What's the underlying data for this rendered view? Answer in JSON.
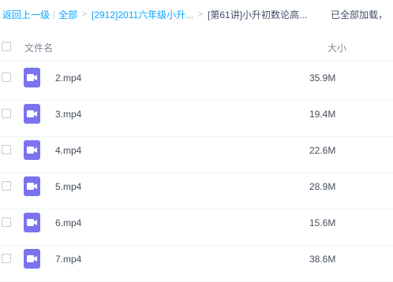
{
  "breadcrumb": {
    "back": "返回上一级",
    "separator": "|",
    "all": "全部",
    "arrow": ">",
    "folder": "[2912]2011六年级小升...",
    "current": "[第61讲]小升初数论高...",
    "status": "已全部加载，"
  },
  "columns": {
    "name": "文件名",
    "size": "大小"
  },
  "files": [
    {
      "name": "2.mp4",
      "size": "35.9M",
      "icon": "video-file-icon"
    },
    {
      "name": "3.mp4",
      "size": "19.4M",
      "icon": "video-file-icon"
    },
    {
      "name": "4.mp4",
      "size": "22.6M",
      "icon": "video-file-icon"
    },
    {
      "name": "5.mp4",
      "size": "28.9M",
      "icon": "video-file-icon"
    },
    {
      "name": "6.mp4",
      "size": "15.6M",
      "icon": "video-file-icon"
    },
    {
      "name": "7.mp4",
      "size": "38.6M",
      "icon": "video-file-icon"
    }
  ],
  "colors": {
    "link": "#06a7ff",
    "video_icon": "#7b73ee"
  }
}
